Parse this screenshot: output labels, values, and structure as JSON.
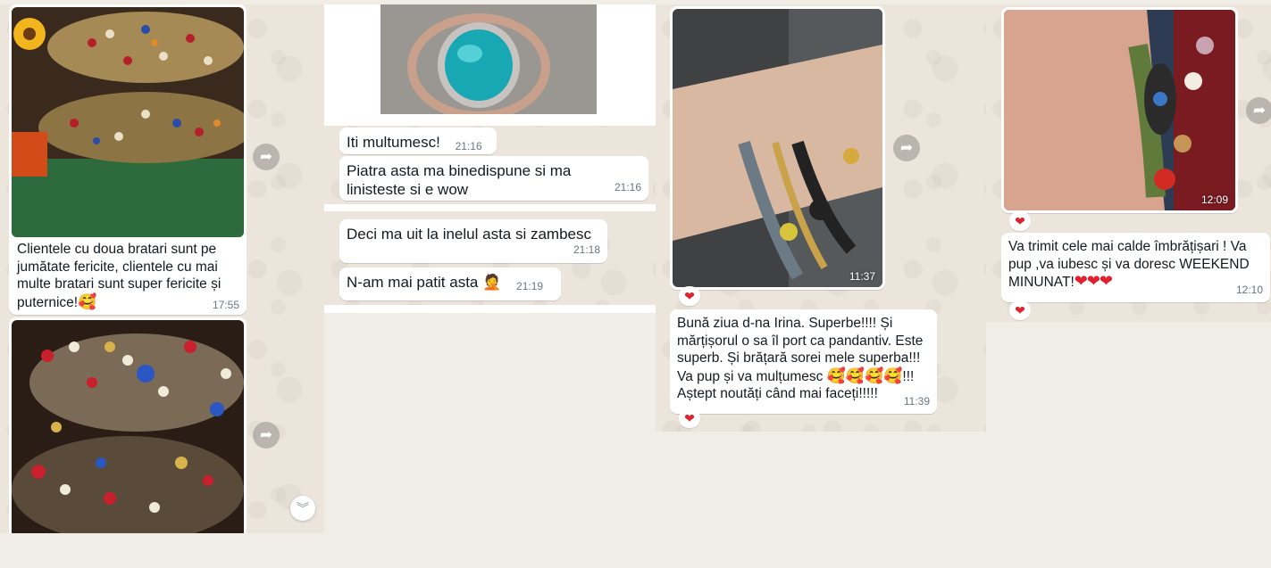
{
  "panel1": {
    "msg1": {
      "caption": "Clientele cu doua bratari sunt pe jumătate fericite, clientele cu mai multe bratari sunt super fericite și puternice!",
      "caption_emoji": "🥰",
      "time": "17:55"
    },
    "msg2": {}
  },
  "panel2": {
    "messages": [
      {
        "text": "Iti multumesc!",
        "time": "21:16"
      },
      {
        "text": "Piatra asta ma binedispune si ma linisteste si e wow",
        "time": "21:16"
      },
      {
        "text": "Deci ma uit la inelul asta si zambesc",
        "time": "21:18"
      },
      {
        "text": "N-am mai patit asta",
        "emoji": "🤦",
        "time": "21:19"
      }
    ]
  },
  "panel3": {
    "photo_time": "11:37",
    "reaction": "❤",
    "message": {
      "text": "Bună ziua d-na Irina. Superbe!!!! Și mărțișorul o sa îl port ca pandantiv. Este superb. Și brățară sorei mele superba!!! Va pup și va mulțumesc",
      "emojis": "🥰🥰🥰🥰",
      "text_after_emojis": "!!! Aștept noutăți când mai faceți!!!!!",
      "time": "11:39"
    }
  },
  "panel4": {
    "photo_time": "12:09",
    "reaction": "❤",
    "message": {
      "text": "Va trimit cele mai calde îmbrățișari ! Va pup ,va iubesc și va doresc WEEKEND MINUNAT!",
      "hearts": "❤❤❤",
      "time": "12:10"
    }
  },
  "icons": {
    "forward": "forward-icon",
    "heart": "heart-reaction-icon",
    "scroll_down": "chevron-double-down-icon"
  },
  "colors": {
    "chat_background": "#ece5dc",
    "bubble": "#ffffff",
    "timestamp": "#667781",
    "heart": "#e0212e"
  }
}
